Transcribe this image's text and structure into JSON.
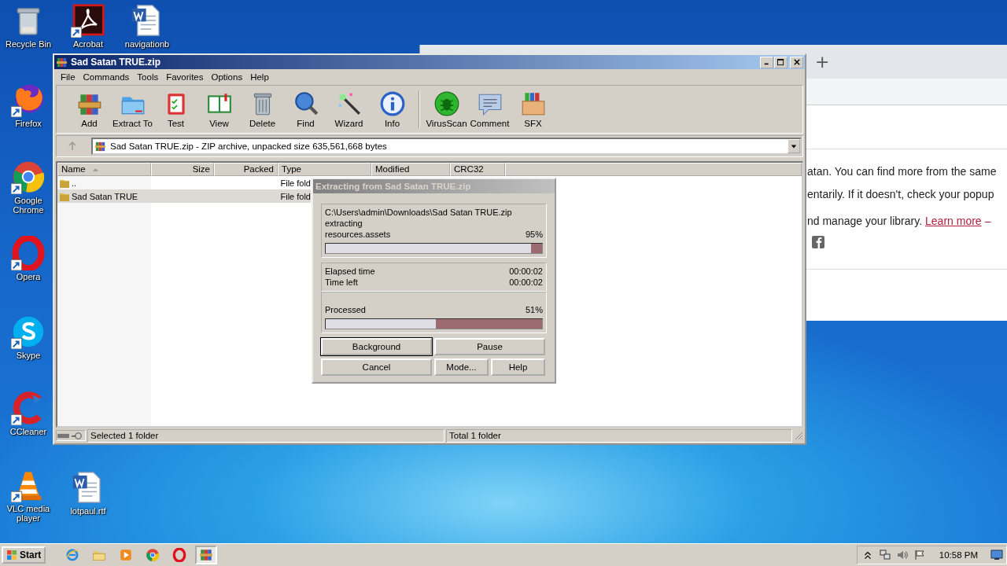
{
  "desktop_icons": [
    {
      "label": "Recycle Bin",
      "kind": "trash",
      "shortcut": false
    },
    {
      "label": "Acrobat",
      "kind": "pdf",
      "shortcut": true
    },
    {
      "label": "navigationb",
      "kind": "doc",
      "shortcut": false
    },
    {
      "label": "Firefox",
      "kind": "firefox",
      "shortcut": true
    },
    {
      "label": "Google Chrome",
      "kind": "chrome",
      "shortcut": true
    },
    {
      "label": "Opera",
      "kind": "opera",
      "shortcut": true
    },
    {
      "label": "Skype",
      "kind": "skype",
      "shortcut": true
    },
    {
      "label": "CCleaner",
      "kind": "ccleaner",
      "shortcut": true
    },
    {
      "label": "VLC media player",
      "kind": "vlc",
      "shortcut": true
    },
    {
      "label": "lotpaul.rtf",
      "kind": "doc",
      "shortcut": false
    }
  ],
  "browser": {
    "new_tab": "+",
    "lines": [
      "atan. You can find more from the same",
      "entarily. If it doesn't, check your popup"
    ],
    "library_text": "nd manage your library.",
    "link": "Learn more",
    "link_tail": "–"
  },
  "window": {
    "title": "Sad Satan TRUE.zip",
    "menu": [
      "File",
      "Commands",
      "Tools",
      "Favorites",
      "Options",
      "Help"
    ],
    "toolbar": [
      {
        "label": "Add",
        "kind": "add"
      },
      {
        "label": "Extract To",
        "kind": "extract"
      },
      {
        "label": "Test",
        "kind": "test"
      },
      {
        "label": "View",
        "kind": "view"
      },
      {
        "label": "Delete",
        "kind": "delete"
      },
      {
        "label": "Find",
        "kind": "find"
      },
      {
        "label": "Wizard",
        "kind": "wizard"
      },
      {
        "label": "Info",
        "kind": "info"
      },
      {
        "label": "VirusScan",
        "kind": "virus"
      },
      {
        "label": "Comment",
        "kind": "comment"
      },
      {
        "label": "SFX",
        "kind": "sfx"
      }
    ],
    "address": "Sad Satan TRUE.zip - ZIP archive, unpacked size 635,561,668 bytes",
    "columns": [
      "Name",
      "Size",
      "Packed",
      "Type",
      "Modified",
      "CRC32"
    ],
    "rows": [
      {
        "name": "..",
        "type": "File fold",
        "selected": false
      },
      {
        "name": "Sad Satan TRUE",
        "type": "File fold",
        "selected": true
      }
    ],
    "status_left": "Selected 1 folder",
    "status_right": "Total 1 folder"
  },
  "dialog": {
    "title": "Extracting from Sad Satan TRUE.zip",
    "archive": "C:\\Users\\admin\\Downloads\\Sad Satan TRUE.zip",
    "action": "extracting",
    "file": {
      "name": "resources.assets",
      "percent": "95%",
      "level": 0.95
    },
    "times": [
      {
        "label": "Elapsed time",
        "value": "00:00:02"
      },
      {
        "label": "Time left",
        "value": "00:00:02"
      }
    ],
    "processed": {
      "label": "Processed",
      "percent": "51%",
      "level": 0.51
    },
    "buttons": [
      {
        "label": "Background",
        "focused": true
      },
      {
        "label": "Pause",
        "focused": false
      },
      {
        "label": "Cancel",
        "focused": false
      },
      {
        "label": "Mode...",
        "focused": false
      },
      {
        "label": "Help",
        "focused": false
      }
    ]
  },
  "taskbar": {
    "start": "Start",
    "items": [
      {
        "kind": "ie",
        "active": false
      },
      {
        "kind": "folder",
        "active": false
      },
      {
        "kind": "media",
        "active": false
      },
      {
        "kind": "chrome",
        "active": false
      },
      {
        "kind": "opera",
        "active": false
      },
      {
        "kind": "winrar",
        "active": true
      }
    ],
    "clock": "10:58 PM"
  }
}
